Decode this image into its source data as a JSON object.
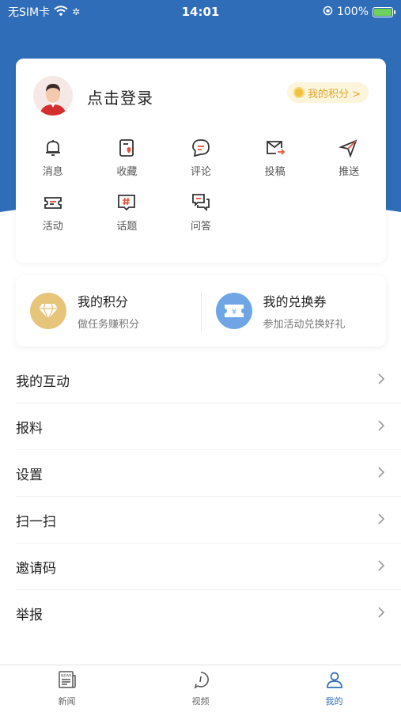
{
  "status_bar": {
    "carrier": "无SIM卡",
    "time": "14:01",
    "battery": "100%"
  },
  "colors": {
    "brand_blue": "#2f6db8",
    "points_gold": "#e1a72a",
    "badge_blue": "#6fa5e4",
    "diamond_gold": "#e6c47a"
  },
  "profile": {
    "login_text": "点击登录",
    "points_pill": "我的积分 >"
  },
  "grid_menu": [
    {
      "label": "消息",
      "icon": "bell-icon"
    },
    {
      "label": "收藏",
      "icon": "favorite-icon"
    },
    {
      "label": "评论",
      "icon": "comment-icon"
    },
    {
      "label": "投稿",
      "icon": "mail-send-icon"
    },
    {
      "label": "推送",
      "icon": "send-icon"
    },
    {
      "label": "活动",
      "icon": "ticket-icon"
    },
    {
      "label": "话题",
      "icon": "hashtag-icon"
    },
    {
      "label": "问答",
      "icon": "qa-icon"
    }
  ],
  "rewards": {
    "points": {
      "title": "我的积分",
      "subtitle": "做任务赚积分"
    },
    "coupons": {
      "title": "我的兑换券",
      "subtitle": "参加活动兑换好礼"
    }
  },
  "list_items": [
    "我的互动",
    "报料",
    "设置",
    "扫一扫",
    "邀请码",
    "举报"
  ],
  "tabs": [
    {
      "label": "新闻",
      "icon": "news-icon",
      "active": false
    },
    {
      "label": "视频",
      "icon": "video-icon",
      "active": false
    },
    {
      "label": "我的",
      "icon": "user-icon",
      "active": true
    }
  ]
}
